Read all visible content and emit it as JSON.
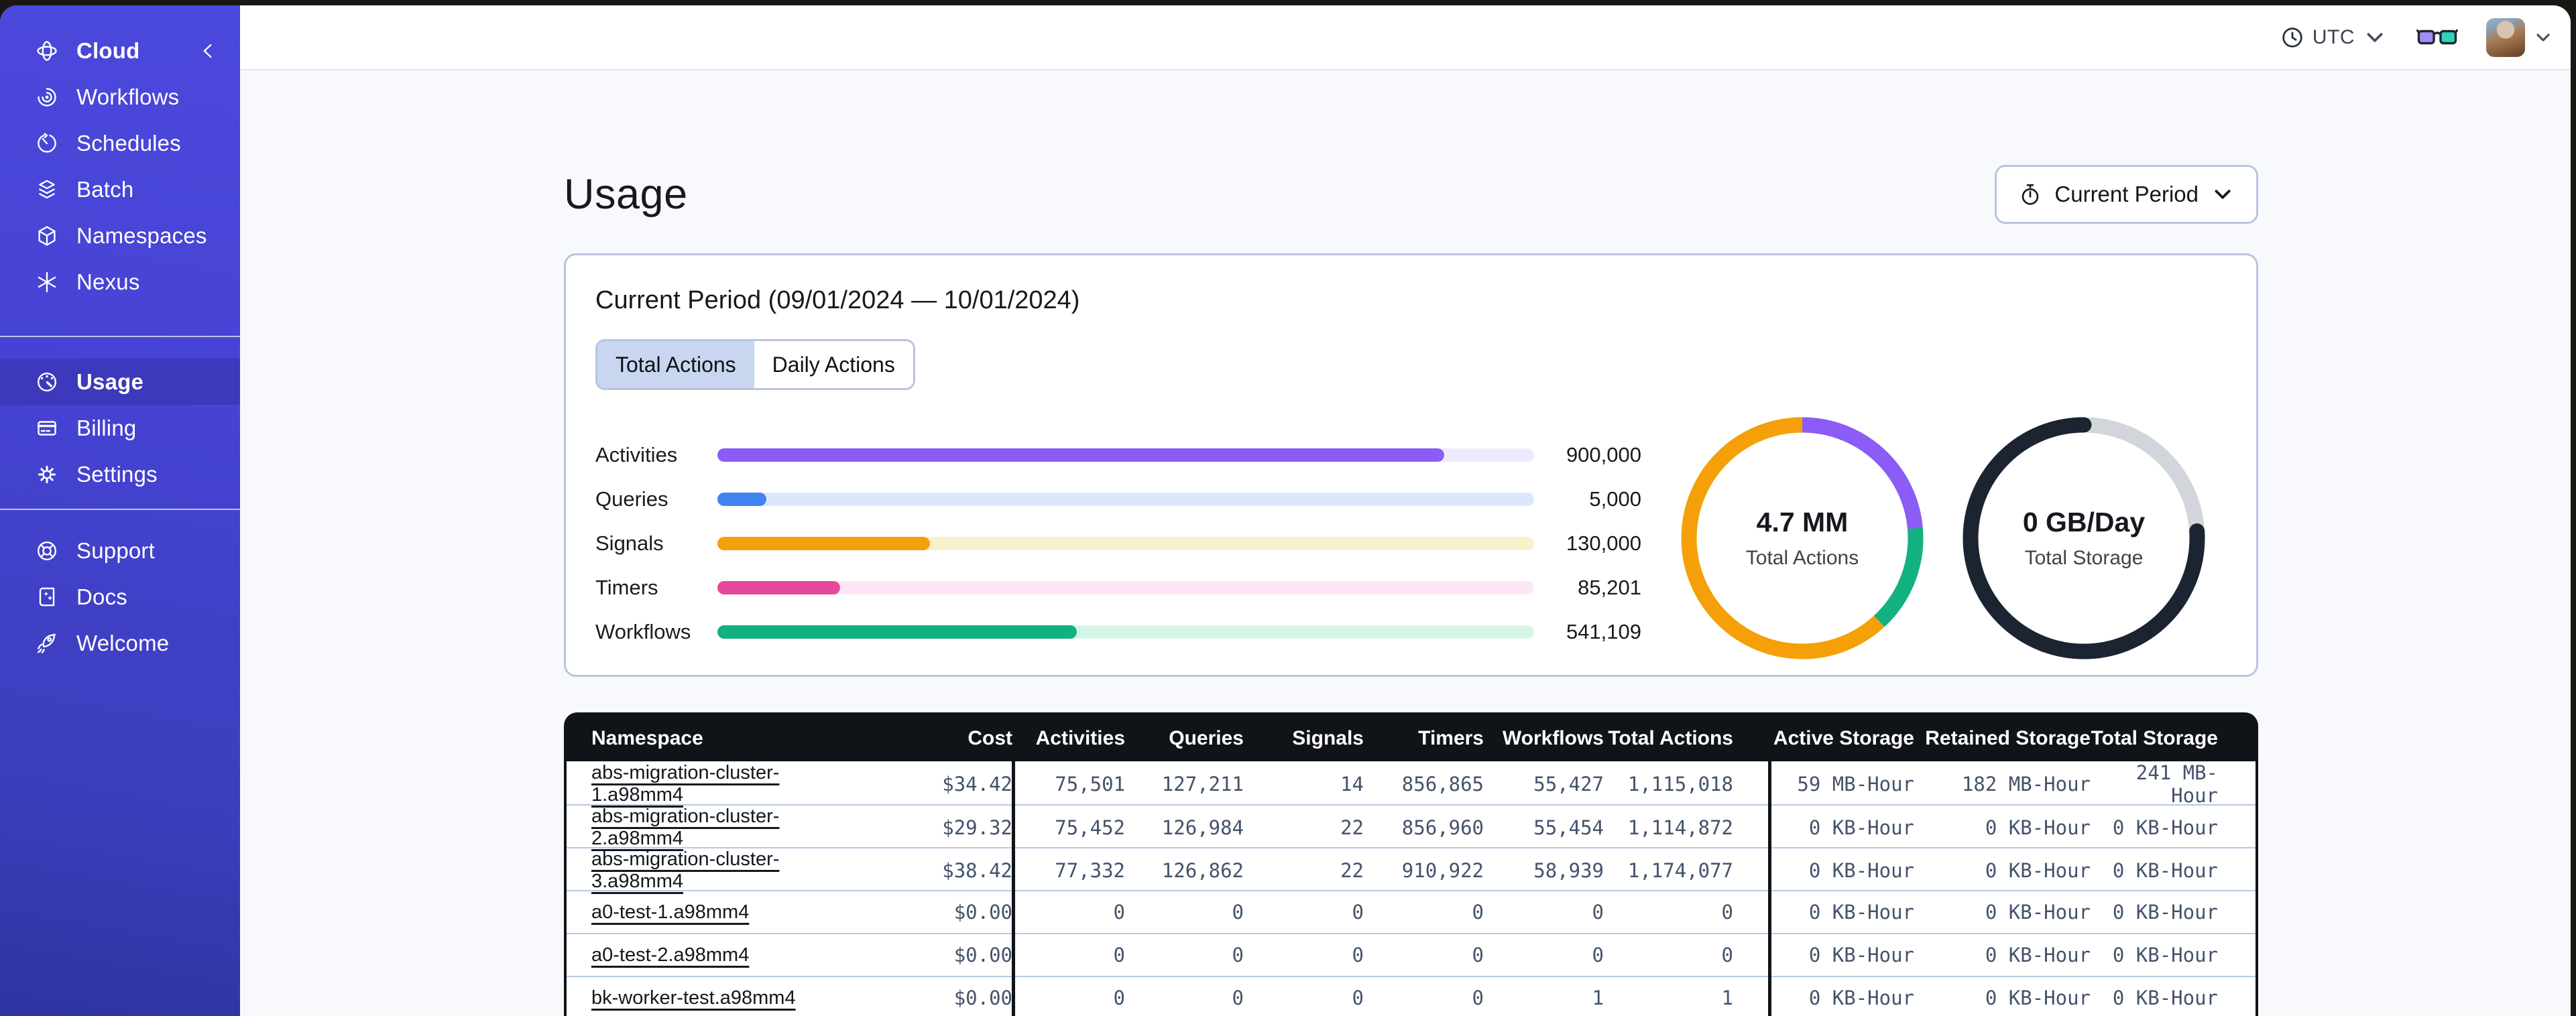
{
  "colors": {
    "sidebar": "#4643D4",
    "sidebar_active": "#3D39BC",
    "card_border": "#B9C4DF",
    "table_header": "#101318",
    "content_bg": "#F8F9FC",
    "active_tab_bg": "#C8D6F0",
    "link_color": "#14171C",
    "cell_color": "#44536B"
  },
  "sidebar": {
    "brand": {
      "label": "Cloud",
      "icon": "cloud-logo-icon",
      "collapse_icon": "chevron-left-icon"
    },
    "nav_primary": [
      {
        "label": "Workflows",
        "icon": "workflows-icon",
        "active": false
      },
      {
        "label": "Schedules",
        "icon": "schedules-icon",
        "active": false
      },
      {
        "label": "Batch",
        "icon": "batch-icon",
        "active": false
      },
      {
        "label": "Namespaces",
        "icon": "namespaces-icon",
        "active": false
      },
      {
        "label": "Nexus",
        "icon": "nexus-icon",
        "active": false
      }
    ],
    "nav_account": [
      {
        "label": "Usage",
        "icon": "usage-icon",
        "active": true
      },
      {
        "label": "Billing",
        "icon": "billing-icon",
        "active": false
      },
      {
        "label": "Settings",
        "icon": "settings-icon",
        "active": false
      }
    ],
    "nav_footer": [
      {
        "label": "Support",
        "icon": "support-icon",
        "active": false
      },
      {
        "label": "Docs",
        "icon": "docs-icon",
        "active": false
      },
      {
        "label": "Welcome",
        "icon": "welcome-icon",
        "active": false
      }
    ]
  },
  "topbar": {
    "timezone": {
      "icon": "clock-icon",
      "label": "UTC",
      "chevron": "chevron-down-icon"
    },
    "feedback_icon": "glasses-icon",
    "avatar": {
      "icon": "user-avatar",
      "chevron": "chevron-down-icon"
    }
  },
  "page": {
    "title": "Usage",
    "period_button": {
      "icon": "stopwatch-icon",
      "label": "Current Period",
      "chevron": "chevron-down-icon"
    }
  },
  "usage_card": {
    "title": "Current Period (09/01/2024 — 10/01/2024)",
    "tabs": [
      {
        "label": "Total Actions",
        "active": true
      },
      {
        "label": "Daily Actions",
        "active": false
      }
    ]
  },
  "chart_data": [
    {
      "type": "bar",
      "title": "Actions by type (current period)",
      "categories": [
        "Activities",
        "Queries",
        "Signals",
        "Timers",
        "Workflows"
      ],
      "values": [
        900000,
        5000,
        130000,
        85201,
        541109
      ],
      "value_labels": [
        "900,000",
        "5,000",
        "130,000",
        "85,201",
        "541,109"
      ],
      "fill_percent": [
        89,
        6,
        26,
        15,
        44
      ],
      "bar_colors": [
        "#8B5CF6",
        "#4283F2",
        "#F5A009",
        "#E8489B",
        "#12B181"
      ],
      "track_colors": [
        "#EFE9FD",
        "#DBE8FC",
        "#FBF0CC",
        "#FDE7F4",
        "#D5F6E7"
      ],
      "xlabel": "",
      "ylabel": "",
      "legend": "none",
      "grid": false
    },
    {
      "type": "pie",
      "center_value": "4.7 MM",
      "center_label": "Total Actions",
      "segments": [
        {
          "color": "#8B5CF6",
          "percent": 23.6,
          "offset": 0
        },
        {
          "color": "#12B181",
          "percent": 14.5,
          "offset": 23.6
        },
        {
          "color": "#F5A009",
          "percent": 61.9,
          "offset": 38.1
        }
      ]
    },
    {
      "type": "pie",
      "center_value": "0 GB/Day",
      "center_label": "Total Storage",
      "segments": [
        {
          "color": "#D2D5DB",
          "percent": 23.5,
          "offset": 0.5
        },
        {
          "color": "#1C2432",
          "percent": 76.0,
          "offset": 24.0,
          "cap": "round"
        }
      ]
    }
  ],
  "table": {
    "headers": [
      "Namespace",
      "Cost",
      "Activities",
      "Queries",
      "Signals",
      "Timers",
      "Workflows",
      "Total Actions",
      "Active Storage",
      "Retained Storage",
      "Total Storage"
    ],
    "rows": [
      [
        "abs-migration-cluster-1.a98mm4",
        "$34.42",
        "75,501",
        "127,211",
        "14",
        "856,865",
        "55,427",
        "1,115,018",
        "59 MB-Hour",
        "182 MB-Hour",
        "241 MB-Hour"
      ],
      [
        "abs-migration-cluster-2.a98mm4",
        "$29.32",
        "75,452",
        "126,984",
        "22",
        "856,960",
        "55,454",
        "1,114,872",
        "0 KB-Hour",
        "0 KB-Hour",
        "0 KB-Hour"
      ],
      [
        "abs-migration-cluster-3.a98mm4",
        "$38.42",
        "77,332",
        "126,862",
        "22",
        "910,922",
        "58,939",
        "1,174,077",
        "0 KB-Hour",
        "0 KB-Hour",
        "0 KB-Hour"
      ],
      [
        "a0-test-1.a98mm4",
        "$0.00",
        "0",
        "0",
        "0",
        "0",
        "0",
        "0",
        "0 KB-Hour",
        "0 KB-Hour",
        "0 KB-Hour"
      ],
      [
        "a0-test-2.a98mm4",
        "$0.00",
        "0",
        "0",
        "0",
        "0",
        "0",
        "0",
        "0 KB-Hour",
        "0 KB-Hour",
        "0 KB-Hour"
      ],
      [
        "bk-worker-test.a98mm4",
        "$0.00",
        "0",
        "0",
        "0",
        "0",
        "1",
        "1",
        "0 KB-Hour",
        "0 KB-Hour",
        "0 KB-Hour"
      ]
    ]
  }
}
